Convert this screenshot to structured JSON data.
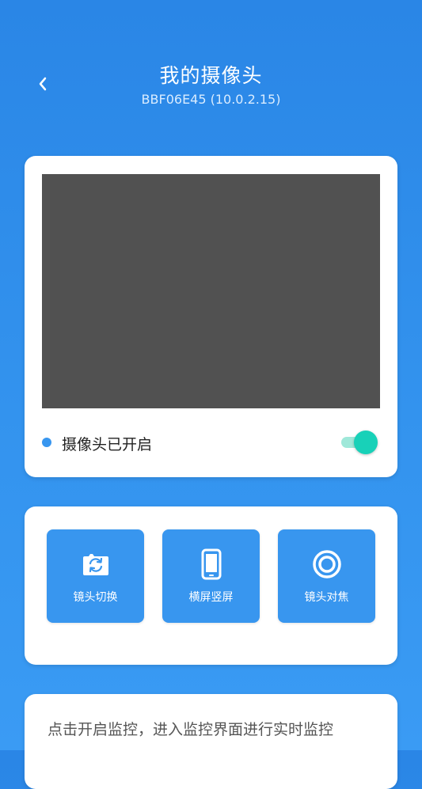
{
  "header": {
    "title": "我的摄像头",
    "subtitle": "BBF06E45 (10.0.2.15)"
  },
  "camera": {
    "status_label": "摄像头已开启",
    "enabled": true,
    "status_dot_color": "#3896ef",
    "toggle_color": "#18d1b8"
  },
  "actions": [
    {
      "label": "镜头切换",
      "icon": "camera-switch-icon"
    },
    {
      "label": "横屏竖屏",
      "icon": "phone-rotate-icon"
    },
    {
      "label": "镜头对焦",
      "icon": "focus-icon"
    }
  ],
  "hint": {
    "text": "点击开启监控，进入监控界面进行实时监控"
  },
  "colors": {
    "background": "#2a86e6",
    "accent": "#3896ef",
    "card": "#ffffff",
    "preview": "#515151"
  }
}
